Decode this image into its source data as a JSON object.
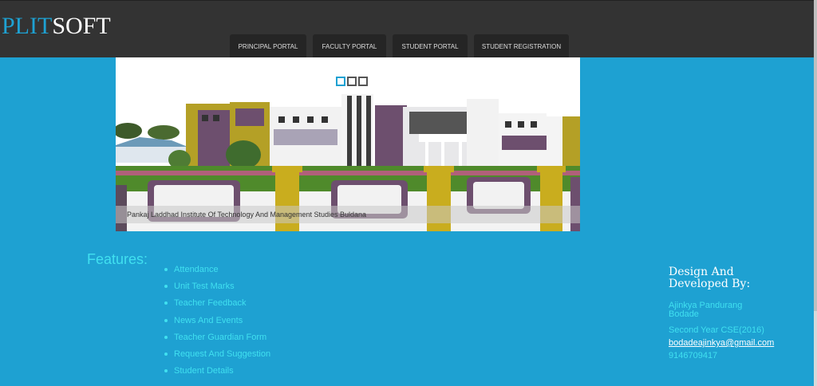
{
  "header": {
    "logo_part1": "PLIT",
    "logo_part2": "SOFT",
    "nav": [
      {
        "label": "PRINCIPAL PORTAL"
      },
      {
        "label": "FACULTY PORTAL"
      },
      {
        "label": "STUDENT PORTAL"
      },
      {
        "label": "STUDENT REGISTRATION"
      }
    ]
  },
  "slider": {
    "caption": "Pankaj Laddhad Institute Of Technology And Management Studies Buldana",
    "slide_count": 3,
    "active_slide": 1
  },
  "features": {
    "title": "Features:",
    "items": [
      "Attendance",
      "Unit Test Marks",
      "Teacher Feedback",
      "News And Events",
      "Teacher Guardian Form",
      "Request And Suggestion",
      "Student Details"
    ]
  },
  "credits": {
    "heading": "Design And Developed By:",
    "name": "Ajinkya Pandurang Bodade",
    "year": "Second Year CSE(2016)",
    "email": "bodadeajinkya@gmail.com",
    "phone": "9146709417"
  },
  "colors": {
    "background": "#1ea1d2",
    "header": "#333333",
    "accent_text": "#40e0f0"
  }
}
